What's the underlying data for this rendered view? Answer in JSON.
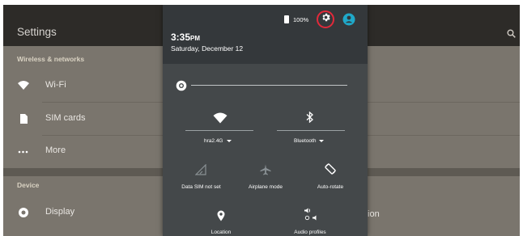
{
  "background": {
    "title": "Settings",
    "sections": [
      {
        "header": "Wireless & networks",
        "items": [
          {
            "label": "Wi-Fi",
            "icon": "wifi-icon"
          },
          {
            "label": "SIM cards",
            "icon": "sim-card-icon"
          },
          {
            "label": "More",
            "icon": "more-icon"
          }
        ]
      },
      {
        "header": "Device",
        "items": [
          {
            "label": "Display",
            "icon": "display-icon"
          }
        ]
      }
    ],
    "partial_text": "tion"
  },
  "status": {
    "battery": "100%"
  },
  "header": {
    "time": "3:35",
    "ampm": "PM",
    "date": "Saturday, December 12"
  },
  "brightness": {
    "level": 1.0
  },
  "tiles": {
    "wifi": {
      "label": "hra2.4G"
    },
    "bluetooth": {
      "label": "Bluetooth"
    },
    "data": {
      "label": "Data SIM not set"
    },
    "airplane": {
      "label": "Airplane mode"
    },
    "rotate": {
      "label": "Auto-rotate"
    },
    "location": {
      "label": "Location"
    },
    "audio": {
      "label": "Audio profiles"
    }
  },
  "colors": {
    "highlight_ring": "#e2293a",
    "user_icon": "#1fa8c9",
    "shade": "#44484a",
    "shade_header": "#34383b"
  }
}
